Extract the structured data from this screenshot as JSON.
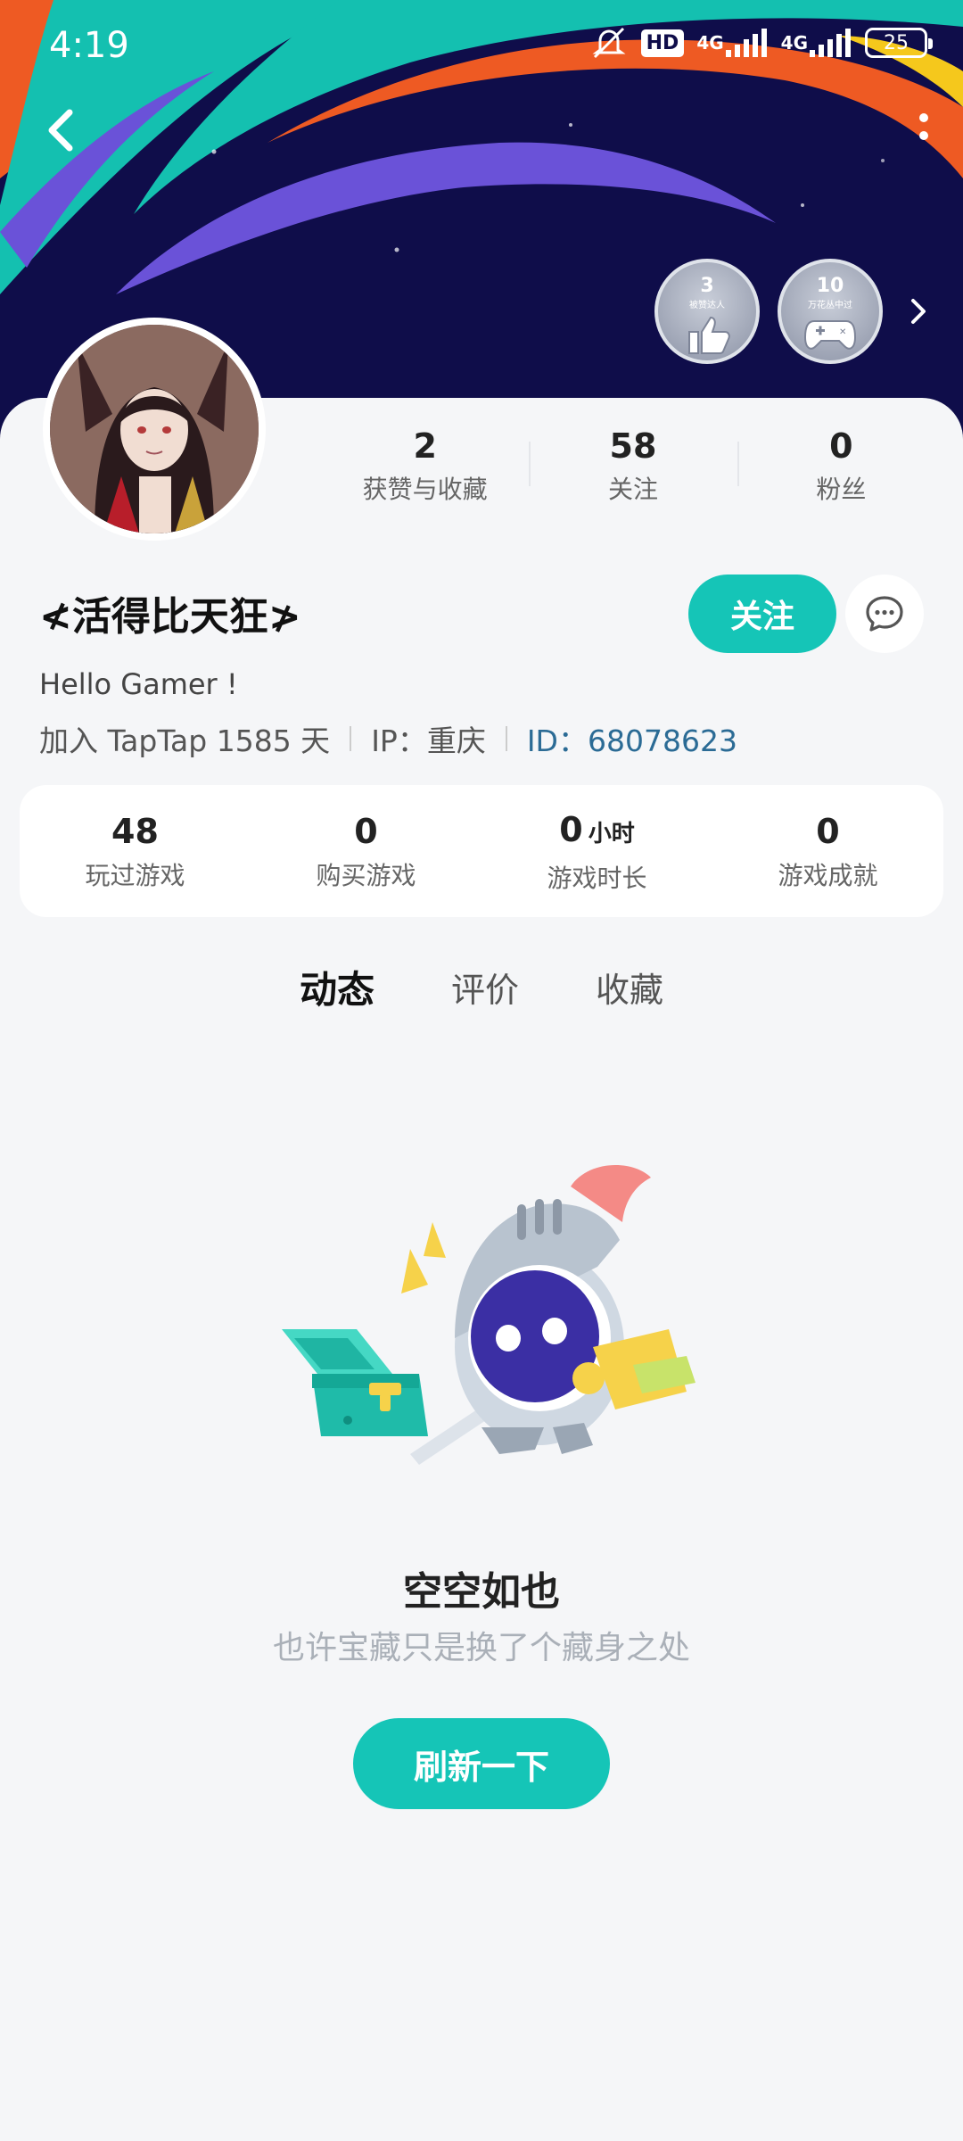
{
  "status_bar": {
    "time": "4:19",
    "hd_label": "HD",
    "network_1": "4G",
    "network_2": "4G",
    "battery": "25"
  },
  "header": {
    "back_icon": "chevron-left-icon",
    "more_icon": "more-vertical-icon",
    "badges": [
      {
        "number": "3",
        "caption": "被赞达人",
        "icon": "thumbs-up-icon"
      },
      {
        "number": "10",
        "caption": "万花丛中过",
        "icon": "gamepad-icon"
      }
    ],
    "badges_more_icon": "chevron-right-icon"
  },
  "profile": {
    "stats": [
      {
        "value": "2",
        "label": "获赞与收藏"
      },
      {
        "value": "58",
        "label": "关注"
      },
      {
        "value": "0",
        "label": "粉丝"
      }
    ],
    "nickname": "≮活得比天狂≯",
    "follow_label": "关注",
    "bio": "Hello Gamer !",
    "joined": "加入 TapTap 1585 天",
    "ip": "IP：重庆",
    "id": "ID：68078623"
  },
  "game_stats": [
    {
      "value": "48",
      "unit": "",
      "label": "玩过游戏"
    },
    {
      "value": "0",
      "unit": "",
      "label": "购买游戏"
    },
    {
      "value": "0",
      "unit": "小时",
      "label": "游戏时长"
    },
    {
      "value": "0",
      "unit": "",
      "label": "游戏成就"
    }
  ],
  "tabs": [
    {
      "label": "动态",
      "active": true
    },
    {
      "label": "评价",
      "active": false
    },
    {
      "label": "收藏",
      "active": false
    }
  ],
  "empty_state": {
    "title": "空空如也",
    "subtitle": "也许宝藏只是换了个藏身之处",
    "refresh_label": "刷新一下"
  },
  "colors": {
    "accent": "#15c5b7",
    "banner_bg": "#0f0d4a",
    "id_link": "#2b6b95"
  }
}
